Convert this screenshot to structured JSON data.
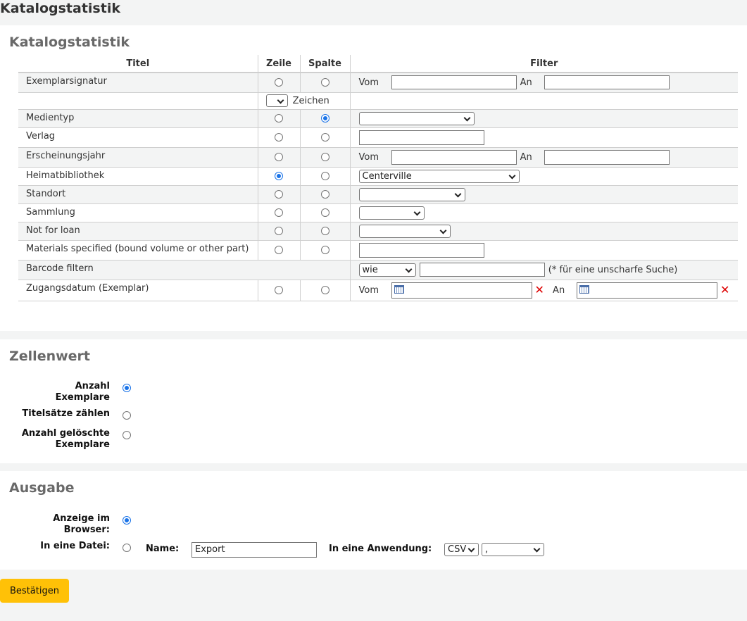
{
  "page_title": "Katalogstatistik",
  "section1": {
    "heading": "Katalogstatistik",
    "columns": {
      "titel": "Titel",
      "zeile": "Zeile",
      "spalte": "Spalte",
      "filter": "Filter"
    },
    "rows": {
      "exemplarsignatur": {
        "label": "Exemplarsignatur",
        "vom": "Vom",
        "an": "An",
        "zeichen": "Zeichen",
        "zeichen_value": ""
      },
      "medientyp": {
        "label": "Medientyp",
        "value": ""
      },
      "verlag": {
        "label": "Verlag",
        "value": ""
      },
      "erscheinungsjahr": {
        "label": "Erscheinungsjahr",
        "vom": "Vom",
        "an": "An"
      },
      "heimatbibliothek": {
        "label": "Heimatbibliothek",
        "value": "Centerville"
      },
      "standort": {
        "label": "Standort",
        "value": ""
      },
      "sammlung": {
        "label": "Sammlung",
        "value": ""
      },
      "not_for_loan": {
        "label": "Not for loan",
        "value": ""
      },
      "materials": {
        "label": "Materials specified (bound volume or other part)",
        "value": ""
      },
      "barcode": {
        "label": "Barcode filtern",
        "mode": "wie",
        "value": "",
        "hint": "(* für eine unscharfe Suche)"
      },
      "zugangsdatum": {
        "label": "Zugangsdatum (Exemplar)",
        "vom": "Vom",
        "an": "An"
      }
    }
  },
  "section2": {
    "heading": "Zellenwert",
    "options": [
      {
        "label_line1": "Anzahl",
        "label_line2": "Exemplare",
        "checked": true
      },
      {
        "label_line1": "Titelsätze zählen",
        "label_line2": "",
        "checked": false
      },
      {
        "label_line1": "Anzahl gelöschte",
        "label_line2": "Exemplare",
        "checked": false
      }
    ]
  },
  "section3": {
    "heading": "Ausgabe",
    "browser": {
      "label_line1": "Anzeige im",
      "label_line2": "Browser:"
    },
    "file": {
      "label": "In eine Datei:",
      "name_label": "Name:",
      "name_value": "Export",
      "app_label": "In eine Anwendung:",
      "format": "CSV",
      "separator": ","
    }
  },
  "submit_label": "Bestätigen",
  "colors": {
    "accent": "#ffc107",
    "heading": "#696969",
    "radio_checked": "#1a73e8",
    "clear_x": "#dd0000"
  },
  "icons": {
    "calendar": "calendar-icon",
    "clear": "clear-date-icon"
  }
}
